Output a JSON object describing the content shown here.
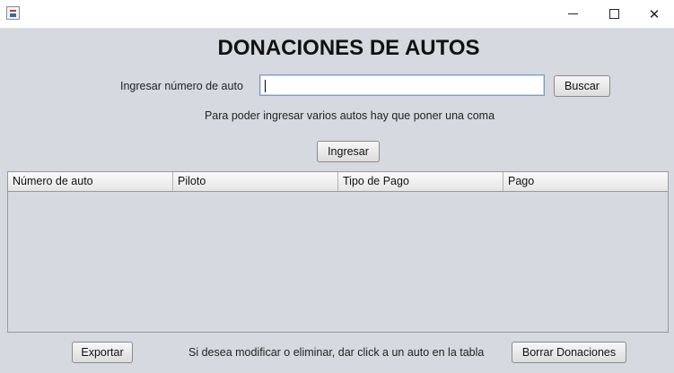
{
  "window": {
    "controls": {
      "minimize": "minimize",
      "maximize": "maximize",
      "close": "close"
    }
  },
  "header": {
    "title": "DONACIONES DE AUTOS"
  },
  "search": {
    "label": "Ingresar número de auto",
    "value": "",
    "button": "Buscar"
  },
  "hint": "Para poder ingresar varios autos hay que poner una coma",
  "actions": {
    "ingresar": "Ingresar"
  },
  "table": {
    "columns": [
      "Número de auto",
      "Piloto",
      "Tipo de Pago",
      "Pago"
    ],
    "rows": []
  },
  "footer": {
    "export_button": "Exportar",
    "note": "Si desea modificar o eliminar, dar click a un auto en la tabla",
    "clear_button": "Borrar Donaciones"
  },
  "colors": {
    "background": "#d6d9df",
    "field_border": "#7a9cc7"
  }
}
